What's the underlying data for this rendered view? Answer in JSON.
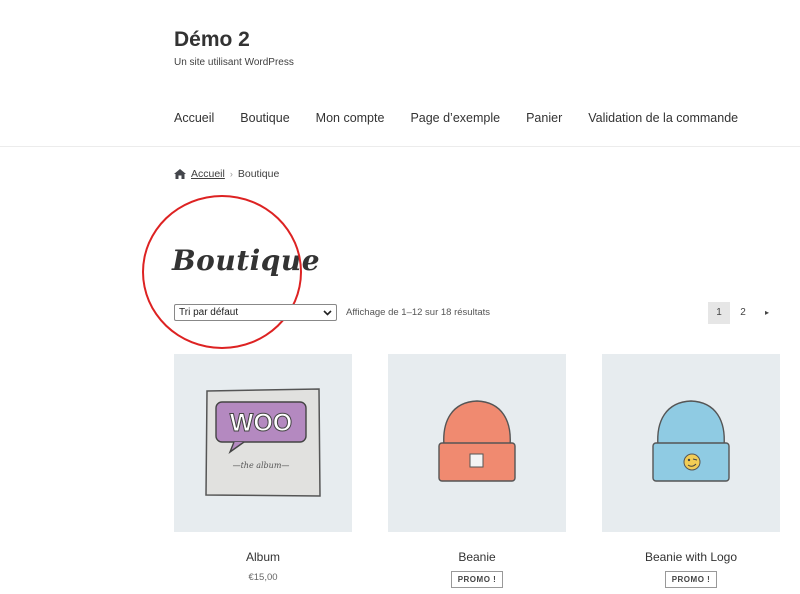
{
  "site": {
    "title": "Démo 2",
    "description": "Un site utilisant WordPress"
  },
  "nav": [
    "Accueil",
    "Boutique",
    "Mon compte",
    "Page d’exemple",
    "Panier",
    "Validation de la commande"
  ],
  "breadcrumb": {
    "home": "Accueil",
    "separator": "›",
    "current": "Boutique"
  },
  "page_title": "Boutique",
  "sort": {
    "selected": "Tri par défaut"
  },
  "result_count": "Affichage de 1–12 sur 18 résultats",
  "pagination": {
    "pages": [
      "1",
      "2"
    ],
    "current": "1",
    "next": "▸"
  },
  "products": [
    {
      "name": "Album",
      "price": "€15,00",
      "art": {
        "label": "WOO",
        "subtitle": "—the album—"
      }
    },
    {
      "name": "Beanie",
      "badge": "PROMO !"
    },
    {
      "name": "Beanie with Logo",
      "badge": "PROMO !"
    }
  ],
  "colors": {
    "highlight_circle": "#dd2222",
    "thumb_bg": "#e7ecef",
    "woo_purple": "#b489c0",
    "beanie_orange": "#f08a70",
    "beanie_blue": "#8fcbe3"
  }
}
